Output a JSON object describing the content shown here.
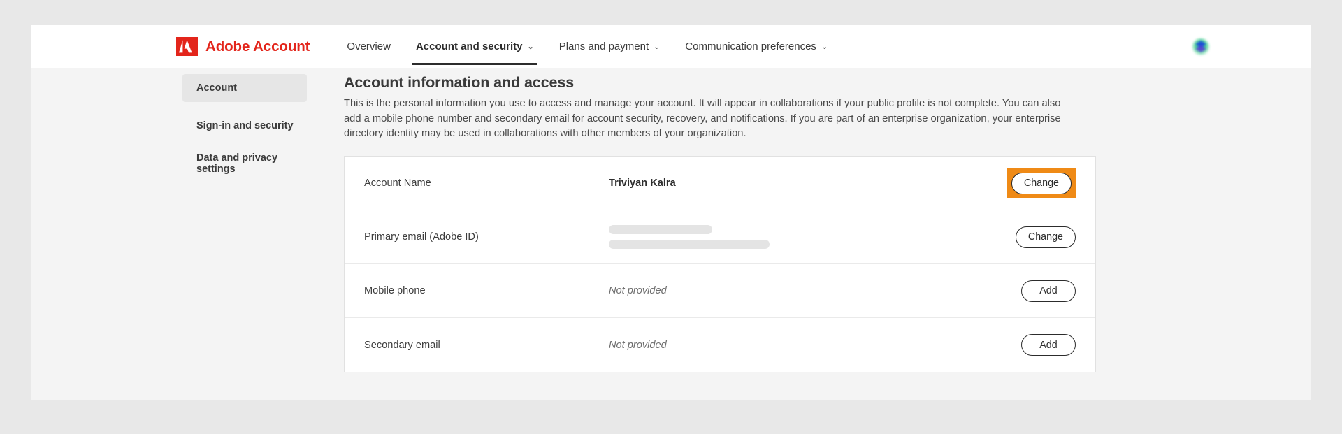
{
  "header": {
    "logo_icon": "adobe-logo-icon",
    "brand": "Adobe Account",
    "nav": [
      {
        "label": "Overview",
        "has_caret": false,
        "active": false
      },
      {
        "label": "Account and security",
        "has_caret": true,
        "active": true
      },
      {
        "label": "Plans and payment",
        "has_caret": true,
        "active": false
      },
      {
        "label": "Communication preferences",
        "has_caret": true,
        "active": false
      }
    ],
    "caret_glyph": "⌄",
    "avatar_icon": "user-avatar-icon",
    "brand_color": "#e3251b"
  },
  "sidebar": {
    "items": [
      {
        "label": "Account",
        "selected": true
      },
      {
        "label": "Sign-in and security",
        "selected": false
      },
      {
        "label": "Data and privacy settings",
        "selected": false
      }
    ]
  },
  "main": {
    "title": "Account information and access",
    "description": "This is the personal information you use to access and manage your account. It will appear in collaborations if your public profile is not complete. You can also add a mobile phone number and secondary email for account security, recovery, and notifications. If you are part of an enterprise organization, your enterprise directory identity may be used in collaborations with other members of your organization.",
    "rows": [
      {
        "label": "Account Name",
        "value": "Triviyan Kalra",
        "value_type": "text",
        "action_label": "Change",
        "highlighted": true
      },
      {
        "label": "Primary email (Adobe ID)",
        "value": "",
        "value_type": "redacted",
        "action_label": "Change",
        "highlighted": false
      },
      {
        "label": "Mobile phone",
        "value": "Not provided",
        "value_type": "muted",
        "action_label": "Add",
        "highlighted": false
      },
      {
        "label": "Secondary email",
        "value": "Not provided",
        "value_type": "muted",
        "action_label": "Add",
        "highlighted": false
      }
    ]
  },
  "colors": {
    "highlight": "#ef8a16",
    "brand_red": "#e3251b",
    "page_bg": "#f4f4f4",
    "outer_bg": "#e8e8e8"
  }
}
